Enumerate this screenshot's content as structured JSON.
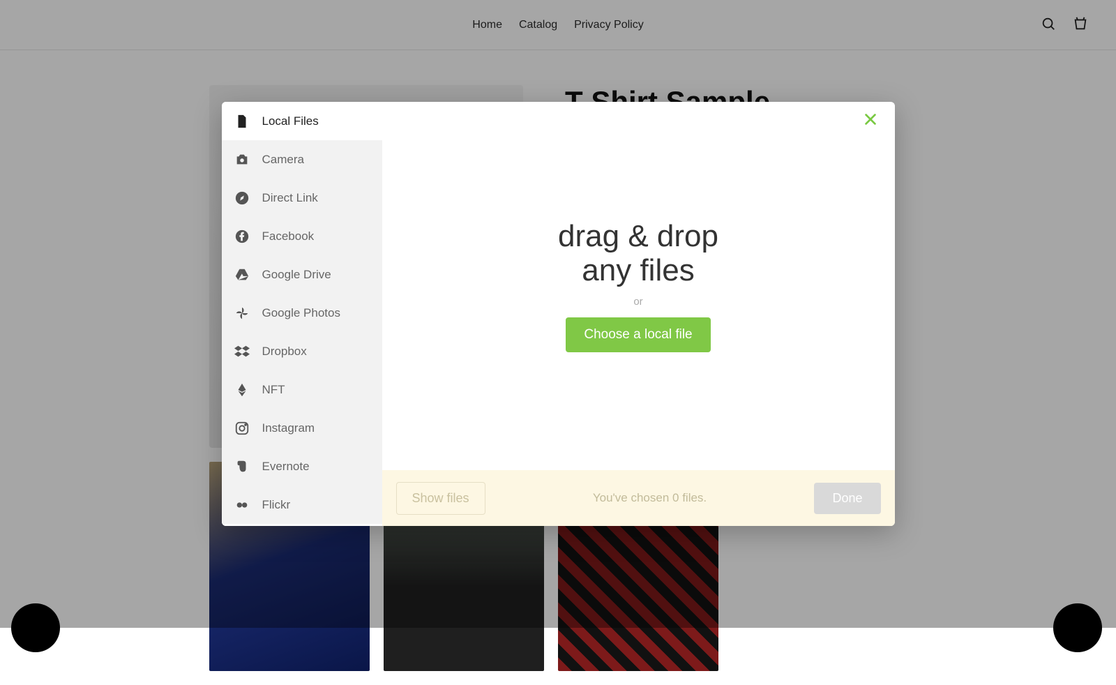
{
  "nav": {
    "links": [
      "Home",
      "Catalog",
      "Privacy Policy"
    ]
  },
  "product": {
    "title": "T-Shirt Sample"
  },
  "modal": {
    "sidebar": [
      {
        "label": "Local Files",
        "icon": "file-icon",
        "active": true
      },
      {
        "label": "Camera",
        "icon": "camera-icon",
        "active": false
      },
      {
        "label": "Direct Link",
        "icon": "compass-icon",
        "active": false
      },
      {
        "label": "Facebook",
        "icon": "facebook-icon",
        "active": false
      },
      {
        "label": "Google Drive",
        "icon": "google-drive-icon",
        "active": false
      },
      {
        "label": "Google Photos",
        "icon": "google-photos-icon",
        "active": false
      },
      {
        "label": "Dropbox",
        "icon": "dropbox-icon",
        "active": false
      },
      {
        "label": "NFT",
        "icon": "ethereum-icon",
        "active": false
      },
      {
        "label": "Instagram",
        "icon": "instagram-icon",
        "active": false
      },
      {
        "label": "Evernote",
        "icon": "evernote-icon",
        "active": false
      },
      {
        "label": "Flickr",
        "icon": "flickr-icon",
        "active": false
      }
    ],
    "drop_title_line1": "drag & drop",
    "drop_title_line2": "any files",
    "or_label": "or",
    "choose_label": "Choose a local file",
    "show_files_label": "Show files",
    "status_text": "You've chosen 0 files.",
    "done_label": "Done"
  },
  "colors": {
    "accent": "#80c846"
  }
}
